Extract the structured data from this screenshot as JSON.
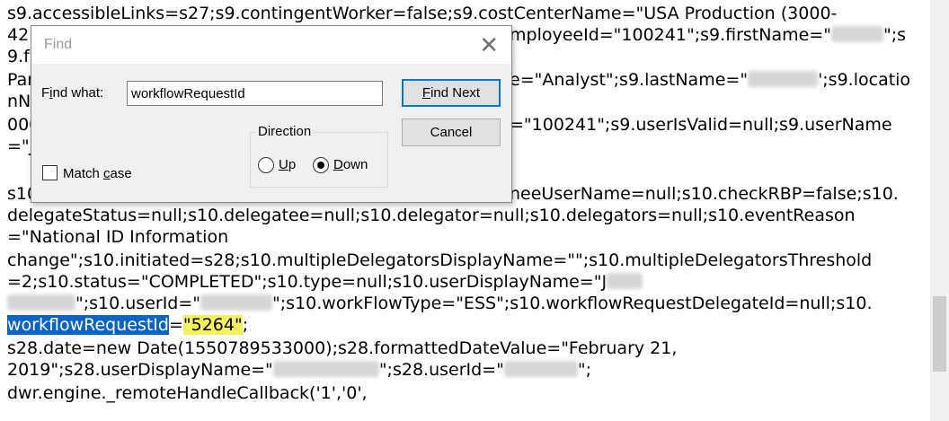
{
  "document": {
    "lines": [
      "s9.accessibleLinks=s27;s9.contingentWorker=false;s9.costCenterName=\"USA Production (3000-",
      "42",
      "9.f",
      "Par",
      "nN",
      "000",
      "=\"J",
      "s10",
      "delegateStatus=null;s10.delegatee=null;s10.delegator=null;s10.delegators=null;s10.eventReason",
      "=\"National ID Information",
      "change\";s10.initiated=s28;s10.multipleDelegatorsDisplayName=\"\";s10.multipleDelegatorsThreshold",
      "=2;s10.status=\"COMPLETED\";s10.type=null;s10.userDisplayName=\"J",
      "\";s10.userId=\"",
      "\";s10.workFlowType=\"ESS\";s10.workflowRequestDelegateId=null;s10.",
      "workflowRequestId",
      "=",
      "\"5264\"",
      ";",
      "s28.date=new Date(1550789533000);s28.formattedDateValue=\"February 21,",
      "2019\";s28.userDisplayName=\"",
      "\";s28.userId=\"",
      "\";",
      "dwr.engine._remoteHandleCallback('1','0',"
    ],
    "right_fragments": {
      "r1": "mployeeId=\"100241\";s9.firstName=\"",
      "r1b": "\";s",
      "r2": "e=\"Analyst\";s9.lastName=\"",
      "r2b": "';s9.locatio",
      "r3": "=\"100241\";s9.userIsValid=null;s9.userName",
      "r4": "neeUserName=null;s10.checkRBP=false;s10."
    }
  },
  "find_dialog": {
    "title": "Find",
    "close_glyph": "✕",
    "find_what_label_pre": "F",
    "find_what_label_u": "i",
    "find_what_label_post": "nd what:",
    "search_value": "workflowRequestId",
    "find_next_label_pre": "",
    "find_next_label_u": "F",
    "find_next_label_post": "ind Next",
    "cancel_label": "Cancel",
    "direction_label": "Direction",
    "up_label_pre": "",
    "up_label_u": "U",
    "up_label_post": "p",
    "down_label_pre": "",
    "down_label_u": "D",
    "down_label_post": "own",
    "match_case_label_pre": "Match ",
    "match_case_label_u": "c",
    "match_case_label_post": "ase",
    "direction_selected": "Down",
    "match_case_checked": false
  }
}
